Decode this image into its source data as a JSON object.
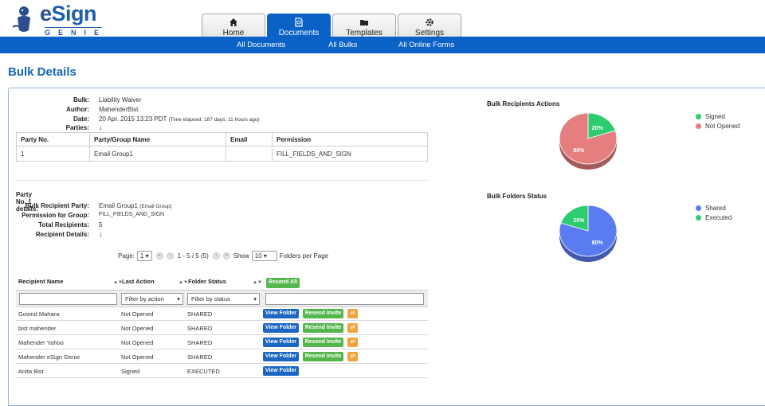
{
  "header": {
    "brand_e": "e",
    "brand_rest": "Sign",
    "brand_sub": "GENIE",
    "tabs": [
      {
        "label": "Home",
        "icon": "home-icon"
      },
      {
        "label": "Documents",
        "icon": "document-icon"
      },
      {
        "label": "Templates",
        "icon": "folder-icon"
      },
      {
        "label": "Settings",
        "icon": "gear-icon"
      }
    ],
    "active_tab": "Documents",
    "accent": "#0a61c6"
  },
  "subnav": [
    "All Documents",
    "All Bulks",
    "All Online Forms"
  ],
  "page_title": "Bulk Details",
  "bulk": {
    "labels": {
      "bulk": "Bulk:",
      "author": "Author:",
      "date": "Date:",
      "parties": "Parties:"
    },
    "name": "Liability Waiver",
    "author": "MahenderBist",
    "date": "20 Apr. 2015 13:23 PDT",
    "elapsed": "(Time elapsed: 187 days, 11 hours ago)",
    "parties_toggle": "↓"
  },
  "parties_table": {
    "headers": [
      "Party No.",
      "Party/Group Name",
      "Email",
      "Permission"
    ],
    "rows": [
      [
        "1",
        "Email Group1",
        "",
        "FILL_FIELDS_AND_SIGN"
      ]
    ]
  },
  "party_details": {
    "heading": "Party No. 1 details:",
    "labels": {
      "party": "Bulk Recipient Party:",
      "permission": "Permission for Group:",
      "total": "Total Recipients:",
      "details": "Recipient Details:"
    },
    "party": "Email Group1",
    "party_type": "(Email Group)",
    "permission": "FILL_FIELDS_AND_SIGN",
    "total": "5",
    "details_toggle": "↓"
  },
  "pager": {
    "page_label": "Page:",
    "page_value": "1",
    "range": "1 - 5 / 5 (5)",
    "show_label": "Show",
    "per_page_value": "10",
    "per_page_label": "Folders per Page"
  },
  "recipients": {
    "headers": [
      "Recipient Name",
      "Last Action",
      "Folder Status"
    ],
    "resend_all": "Resend All",
    "filter_action_placeholder": "Filter by action",
    "filter_status_placeholder": "Filter by status",
    "view_label": "View Folder",
    "resend_label": "Resend Invite",
    "rows": [
      {
        "name": "Govind Mahara",
        "action": "Not Opened",
        "status": "SHARED"
      },
      {
        "name": "bist mahender",
        "action": "Not Opened",
        "status": "SHARED"
      },
      {
        "name": "Mahender Yahoo",
        "action": "Not Opened",
        "status": "SHARED"
      },
      {
        "name": "Mahender eSign Genie",
        "action": "Not Opened",
        "status": "SHARED"
      },
      {
        "name": "Anita Bist",
        "action": "Signed",
        "status": "EXECUTED"
      }
    ]
  },
  "chart_data": [
    {
      "type": "pie",
      "title": "Bulk Recipients Actions",
      "categories": [
        "Signed",
        "Not Opened"
      ],
      "values": [
        20,
        80
      ],
      "colors": [
        "#2ecc71",
        "#e57e7e"
      ],
      "legend": "right"
    },
    {
      "type": "pie",
      "title": "Bulk Folders Status",
      "categories": [
        "Shared",
        "Executed"
      ],
      "values": [
        80,
        20
      ],
      "colors": [
        "#5b7cf0",
        "#2ecc71"
      ],
      "legend": "right"
    }
  ]
}
